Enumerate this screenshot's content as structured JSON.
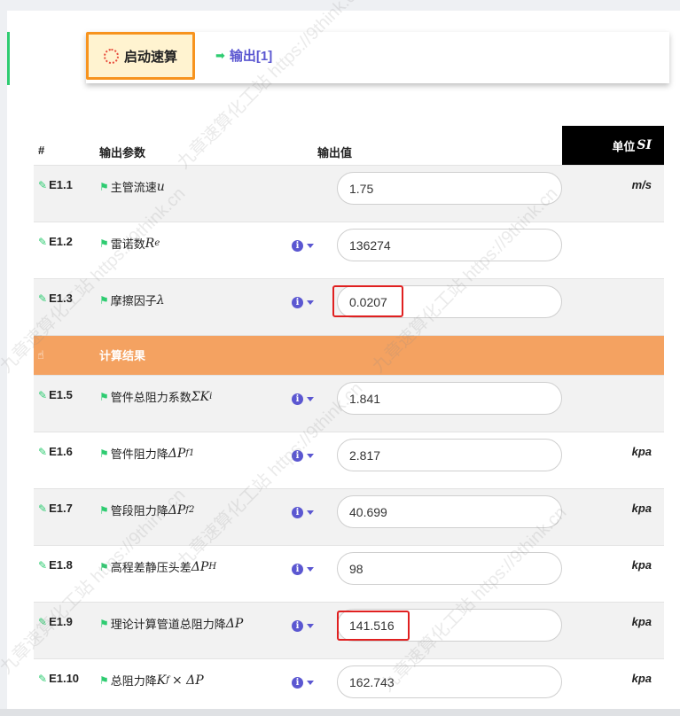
{
  "toolbar": {
    "start_label": "启动速算",
    "output_label": "输出[1]"
  },
  "table": {
    "col_hash": "#",
    "col_param": "输出参数",
    "col_value": "输出值",
    "col_unit": "单位",
    "col_unit_si": "SI"
  },
  "rows": [
    {
      "code": "E1.1",
      "param": "主管流速",
      "sym": "u",
      "sub": "",
      "value": "1.75",
      "unit": "m/s"
    },
    {
      "code": "E1.2",
      "param": "雷诺数",
      "sym": "R",
      "sub": "e",
      "value": "136274",
      "unit": ""
    },
    {
      "code": "E1.3",
      "param": "摩擦因子",
      "sym": "λ",
      "sub": "",
      "value": "0.0207",
      "unit": ""
    },
    {
      "code": "E1.5",
      "param": "管件总阻力系数",
      "sym": "ΣK",
      "sub": "i",
      "value": "1.841",
      "unit": ""
    },
    {
      "code": "E1.6",
      "param": "管件阻力降",
      "sym": "ΔP",
      "sub": "f1",
      "value": "2.817",
      "unit": "kpa"
    },
    {
      "code": "E1.7",
      "param": "管段阻力降",
      "sym": "ΔP",
      "sub": "f2",
      "value": "40.699",
      "unit": "kpa"
    },
    {
      "code": "E1.8",
      "param": "高程差静压头差",
      "sym": "ΔP",
      "sub": "H",
      "value": "98",
      "unit": "kpa"
    },
    {
      "code": "E1.9",
      "param": "理论计算管道总阻力降",
      "sym": "ΔP",
      "sub": "",
      "value": "141.516",
      "unit": "kpa"
    },
    {
      "code": "E1.10",
      "param": "总阻力降",
      "sym": "K",
      "sub": "f",
      "sym2": "× ΔP",
      "value": "162.743",
      "unit": "kpa"
    }
  ],
  "section": {
    "title": "计算结果"
  },
  "watermark": {
    "text": "九章速算化工站",
    "url": "https://9think.cn"
  },
  "colors": {
    "accent_green": "#2ecc71",
    "section_orange": "#f4a261",
    "highlight_red": "#e02020",
    "link_purple": "#5b57d1",
    "start_border": "#f7931e"
  }
}
